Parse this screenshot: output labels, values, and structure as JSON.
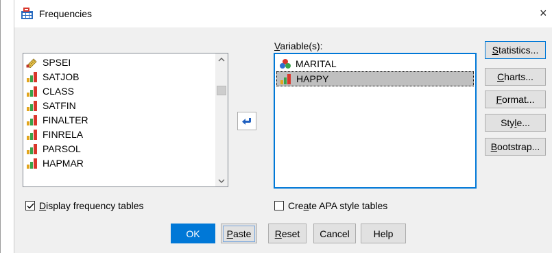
{
  "window": {
    "title": "Frequencies",
    "close_glyph": "×"
  },
  "source_list": {
    "items": [
      {
        "label": "SPSEI",
        "icon": "scale-ruler-icon"
      },
      {
        "label": "SATJOB",
        "icon": "ordinal-bars-icon"
      },
      {
        "label": "CLASS",
        "icon": "ordinal-bars-icon"
      },
      {
        "label": "SATFIN",
        "icon": "ordinal-bars-icon"
      },
      {
        "label": "FINALTER",
        "icon": "ordinal-bars-icon"
      },
      {
        "label": "FINRELA",
        "icon": "ordinal-bars-icon"
      },
      {
        "label": "PARSOL",
        "icon": "ordinal-bars-icon"
      },
      {
        "label": "HAPMAR",
        "icon": "ordinal-bars-icon"
      }
    ]
  },
  "target": {
    "label_prefix": "V",
    "label_rest": "ariable(s):",
    "items": [
      {
        "label": "MARITAL",
        "icon": "nominal-circles-icon",
        "selected": false
      },
      {
        "label": "HAPPY",
        "icon": "ordinal-bars-icon",
        "selected": true
      }
    ]
  },
  "side_buttons": {
    "statistics": {
      "mn": "S",
      "rest": "tatistics..."
    },
    "charts": {
      "mn": "C",
      "rest": "harts..."
    },
    "format": {
      "mn": "F",
      "rest": "ormat..."
    },
    "style_pre": "Sty",
    "style_mn": "l",
    "style_rest": "e...",
    "bootstrap": {
      "mn": "B",
      "rest": "ootstrap..."
    }
  },
  "options": {
    "display_freq_mn": "D",
    "display_freq_rest": "isplay frequency tables",
    "display_freq_checked": true,
    "apa_pre": "Cre",
    "apa_mn": "a",
    "apa_rest": "te APA style tables",
    "apa_checked": false
  },
  "footer": {
    "ok": "OK",
    "paste_mn": "P",
    "paste_rest": "aste",
    "reset_mn": "R",
    "reset_rest": "eset",
    "cancel": "Cancel",
    "help": "Help"
  },
  "colors": {
    "accent": "#0078d7",
    "selected_row": "#bfbfbf",
    "panel": "#f0f0f0"
  }
}
